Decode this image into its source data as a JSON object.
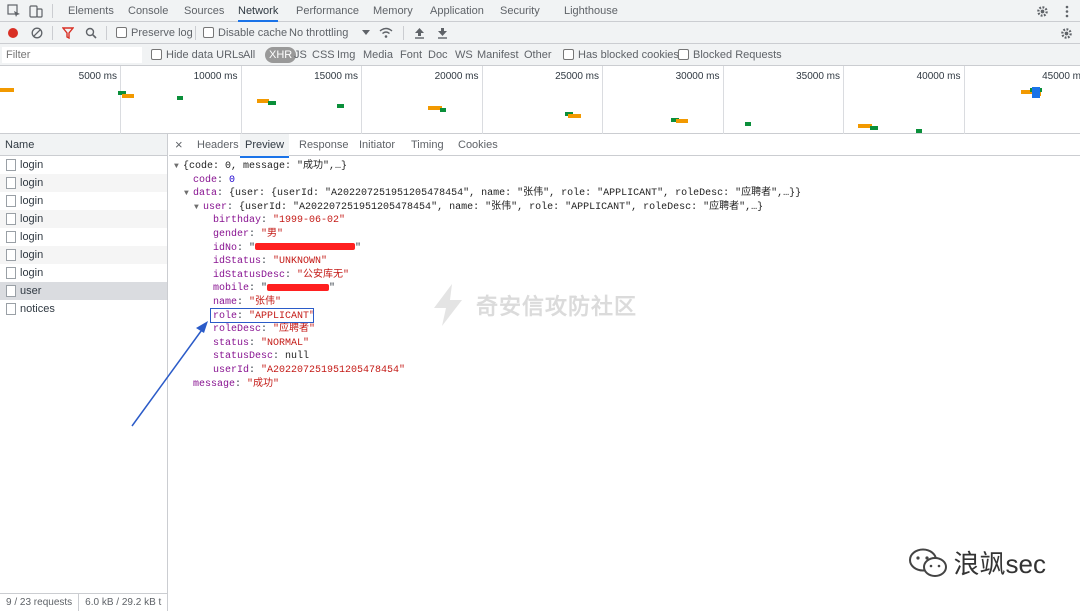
{
  "tabs": [
    "Elements",
    "Console",
    "Sources",
    "Network",
    "Performance",
    "Memory",
    "Application",
    "Security",
    "Lighthouse"
  ],
  "toolbar": {
    "preserve_log": "Preserve log",
    "disable_cache": "Disable cache",
    "throttling": "No throttling"
  },
  "filter": {
    "placeholder": "Filter",
    "hide_data_urls": "Hide data URLs",
    "types": [
      "All",
      "XHR",
      "JS",
      "CSS",
      "Img",
      "Media",
      "Font",
      "Doc",
      "WS",
      "Manifest",
      "Other"
    ],
    "selected_type": "XHR",
    "has_blocked_cookies": "Has blocked cookies",
    "blocked_requests": "Blocked Requests"
  },
  "timeline": {
    "ticks": [
      "5000 ms",
      "10000 ms",
      "15000 ms",
      "20000 ms",
      "25000 ms",
      "30000 ms",
      "35000 ms",
      "40000 ms",
      "45000 m"
    ]
  },
  "requests": {
    "header": "Name",
    "items": [
      "login",
      "login",
      "login",
      "login",
      "login",
      "login",
      "login",
      "user",
      "notices"
    ],
    "selected": "user"
  },
  "status": {
    "requests": "9 / 23 requests",
    "transferred": "6.0 kB / 29.2 kB t"
  },
  "detail_tabs": [
    "Headers",
    "Preview",
    "Response",
    "Initiator",
    "Timing",
    "Cookies"
  ],
  "detail_active": "Preview",
  "preview": {
    "root_summary": "{code: 0, message: \"成功\",…}",
    "code_key": "code",
    "code_val": "0",
    "data_key": "data",
    "data_summary": "{user: {userId: \"A202207251951205478454\", name: \"张伟\", role: \"APPLICANT\", roleDesc: \"应聘者\",…}}",
    "user_key": "user",
    "user_summary": "{userId: \"A202207251951205478454\", name: \"张伟\", role: \"APPLICANT\", roleDesc: \"应聘者\",…}",
    "fields": [
      {
        "k": "birthday",
        "v": "\"1999-06-02\"",
        "t": "s"
      },
      {
        "k": "gender",
        "v": "\"男\"",
        "t": "s"
      },
      {
        "k": "idNo",
        "v": "",
        "t": "redact"
      },
      {
        "k": "idStatus",
        "v": "\"UNKNOWN\"",
        "t": "s"
      },
      {
        "k": "idStatusDesc",
        "v": "\"公安库无\"",
        "t": "s"
      },
      {
        "k": "mobile",
        "v": "",
        "t": "redact"
      },
      {
        "k": "name",
        "v": "\"张伟\"",
        "t": "s"
      },
      {
        "k": "role",
        "v": "\"APPLICANT\"",
        "t": "s"
      },
      {
        "k": "roleDesc",
        "v": "\"应聘者\"",
        "t": "s"
      },
      {
        "k": "status",
        "v": "\"NORMAL\"",
        "t": "s"
      },
      {
        "k": "statusDesc",
        "v": "null",
        "t": "g"
      },
      {
        "k": "userId",
        "v": "\"A202207251951205478454\"",
        "t": "s"
      }
    ],
    "message_key": "message",
    "message_val": "\"成功\""
  },
  "watermark": "奇安信攻防社区",
  "brand": "浪飒sec",
  "colors": {
    "accent": "#1a73e8",
    "highlight_box": "#2b5bc8",
    "arrow": "#2b5bc8",
    "redaction": "#ff2020"
  }
}
